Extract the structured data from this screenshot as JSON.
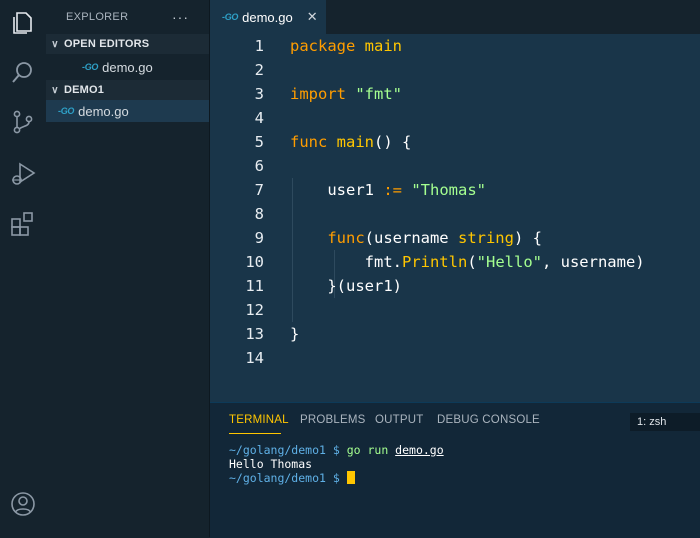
{
  "activity_bar": {
    "icons": [
      "files-icon",
      "search-icon",
      "source-control-icon",
      "run-debug-icon",
      "extensions-icon",
      "account-icon"
    ]
  },
  "sidebar": {
    "title": "EXPLORER",
    "more": "···",
    "open_editors": {
      "label": "OPEN EDITORS",
      "items": [
        {
          "icon": "-GO",
          "label": "demo.go"
        }
      ]
    },
    "folder": {
      "label": "DEMO1",
      "items": [
        {
          "icon": "-GO",
          "label": "demo.go"
        }
      ]
    }
  },
  "tabs": [
    {
      "icon": "-GO",
      "label": "demo.go",
      "close": "✕"
    }
  ],
  "editor": {
    "line_numbers": [
      "1",
      "2",
      "3",
      "4",
      "5",
      "6",
      "7",
      "8",
      "9",
      "10",
      "11",
      "12",
      "13",
      "14"
    ]
  },
  "panel": {
    "tabs": [
      "TERMINAL",
      "PROBLEMS",
      "OUTPUT",
      "DEBUG CONSOLE"
    ],
    "active_tab": "TERMINAL",
    "terminal_select": "1: zsh",
    "terminal": {
      "line1_path": "~/golang/demo1 $ ",
      "line1_cmd": "go run ",
      "line1_arg": "demo.go",
      "line2": "Hello Thomas",
      "line3_path": "~/golang/demo1 $ "
    }
  },
  "colors": {
    "keyword": "#ff9d00",
    "string": "#a5ff90",
    "function": "#ffc600",
    "editor_bg": "#193549",
    "accent": "#ffc600"
  }
}
